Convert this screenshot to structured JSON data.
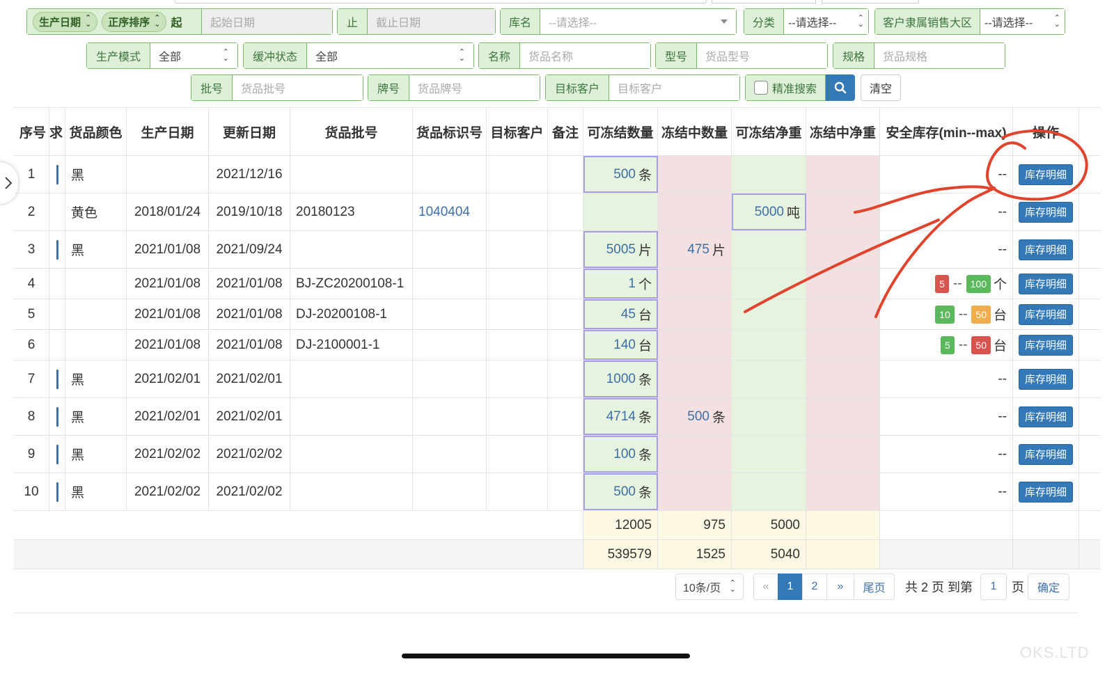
{
  "filters": {
    "prod_date_pill": "生产日期",
    "order_pill": "正序排序",
    "start_label": "起",
    "start_placeholder": "起始日期",
    "end_label": "止",
    "end_placeholder": "截止日期",
    "warehouse_label": "库名",
    "warehouse_value": "--请选择--",
    "category_label": "分类",
    "category_value": "--请选择--",
    "region_label": "客户隶属销售大区",
    "region_value": "--请选择--",
    "mode_label": "生产模式",
    "mode_value": "全部",
    "buffer_label": "缓冲状态",
    "buffer_value": "全部",
    "name_label": "名称",
    "name_placeholder": "货品名称",
    "model_label": "型号",
    "model_placeholder": "货品型号",
    "spec_label": "规格",
    "spec_placeholder": "货品规格",
    "batch_label": "批号",
    "batch_placeholder": "货品批号",
    "brand_label": "牌号",
    "brand_placeholder": "货品牌号",
    "customer_label": "目标客户",
    "customer_placeholder": "目标客户",
    "exact_label": "精准搜索",
    "clear_label": "清空"
  },
  "table": {
    "headers": {
      "seq": "序号",
      "req": "求",
      "color": "货品颜色",
      "prod_date": "生产日期",
      "update_date": "更新日期",
      "batch": "货品批号",
      "code": "货品标识号",
      "customer": "目标客户",
      "note": "备注",
      "freezable_qty": "可冻结数量",
      "freezing_qty": "冻结中数量",
      "freezable_wt": "可冻结净重",
      "freezing_wt": "冻结中净重",
      "safety": "安全库存(min--max)",
      "ops": "操作"
    },
    "rows": [
      {
        "seq": "1",
        "color": "黑",
        "prod": "",
        "upd": "2021/12/16",
        "batch": "",
        "code": "",
        "fq": "500",
        "fq_u": "条",
        "zq": "",
        "zq_u": "",
        "fw": "",
        "fw_u": "",
        "safe_text": "--",
        "bar": true
      },
      {
        "seq": "2",
        "color": "黄色",
        "prod": "2018/01/24",
        "upd": "2019/10/18",
        "batch": "20180123",
        "code": "1040404",
        "fq": "",
        "fq_u": "",
        "zq": "",
        "zq_u": "",
        "fw": "5000",
        "fw_u": "吨",
        "safe_text": "--",
        "bar": false
      },
      {
        "seq": "3",
        "color": "黑",
        "prod": "2021/01/08",
        "upd": "2021/09/24",
        "batch": "",
        "code": "",
        "fq": "5005",
        "fq_u": "片",
        "zq": "475",
        "zq_u": "片",
        "fw": "",
        "fw_u": "",
        "safe_text": "--",
        "bar": true
      },
      {
        "seq": "4",
        "color": "",
        "prod": "2021/01/08",
        "upd": "2021/01/08",
        "batch": "BJ-ZC20200108-1",
        "code": "",
        "fq": "1",
        "fq_u": "个",
        "zq": "",
        "zq_u": "",
        "fw": "",
        "fw_u": "",
        "safe_min": "5",
        "safe_max": "100",
        "safe_unit": "个",
        "min_c": "b-red",
        "max_c": "b-green",
        "bar": false
      },
      {
        "seq": "5",
        "color": "",
        "prod": "2021/01/08",
        "upd": "2021/01/08",
        "batch": "DJ-20200108-1",
        "code": "",
        "fq": "45",
        "fq_u": "台",
        "zq": "",
        "zq_u": "",
        "fw": "",
        "fw_u": "",
        "safe_min": "10",
        "safe_max": "50",
        "safe_unit": "台",
        "min_c": "b-green",
        "max_c": "b-orange",
        "bar": false
      },
      {
        "seq": "6",
        "color": "",
        "prod": "2021/01/08",
        "upd": "2021/01/08",
        "batch": "DJ-2100001-1",
        "code": "",
        "fq": "140",
        "fq_u": "台",
        "zq": "",
        "zq_u": "",
        "fw": "",
        "fw_u": "",
        "safe_min": "5",
        "safe_max": "50",
        "safe_unit": "台",
        "min_c": "b-green",
        "max_c": "b-red",
        "bar": false
      },
      {
        "seq": "7",
        "color": "黑",
        "prod": "2021/02/01",
        "upd": "2021/02/01",
        "batch": "",
        "code": "",
        "fq": "1000",
        "fq_u": "条",
        "zq": "",
        "zq_u": "",
        "fw": "",
        "fw_u": "",
        "safe_text": "--",
        "bar": true
      },
      {
        "seq": "8",
        "color": "黑",
        "prod": "2021/02/01",
        "upd": "2021/02/01",
        "batch": "",
        "code": "",
        "fq": "4714",
        "fq_u": "条",
        "zq": "500",
        "zq_u": "条",
        "fw": "",
        "fw_u": "",
        "safe_text": "--",
        "bar": true
      },
      {
        "seq": "9",
        "color": "黑",
        "prod": "2021/02/02",
        "upd": "2021/02/02",
        "batch": "",
        "code": "",
        "fq": "100",
        "fq_u": "条",
        "zq": "",
        "zq_u": "",
        "fw": "",
        "fw_u": "",
        "safe_text": "--",
        "bar": true
      },
      {
        "seq": "10",
        "color": "黑",
        "prod": "2021/02/02",
        "upd": "2021/02/02",
        "batch": "",
        "code": "",
        "fq": "500",
        "fq_u": "条",
        "zq": "",
        "zq_u": "",
        "fw": "",
        "fw_u": "",
        "safe_text": "--",
        "bar": true
      }
    ],
    "action_label": "库存明细",
    "page_totals": {
      "fq": "12005",
      "zq": "975",
      "fw": "5000"
    },
    "grand_totals": {
      "fq": "539579",
      "zq": "1525",
      "fw": "5040"
    }
  },
  "pagination": {
    "page_size": "10条/页",
    "prev": "«",
    "pages": [
      "1",
      "2"
    ],
    "next": "»",
    "last": "尾页",
    "summary_pre": "共 2 页 到第",
    "goto_value": "1",
    "summary_post": "页",
    "confirm": "确定"
  },
  "watermark": "OKS.LTD",
  "colors": {
    "accent": "#3479b7",
    "annotation": "#e0442c",
    "label_bg": "#dff0d8"
  }
}
